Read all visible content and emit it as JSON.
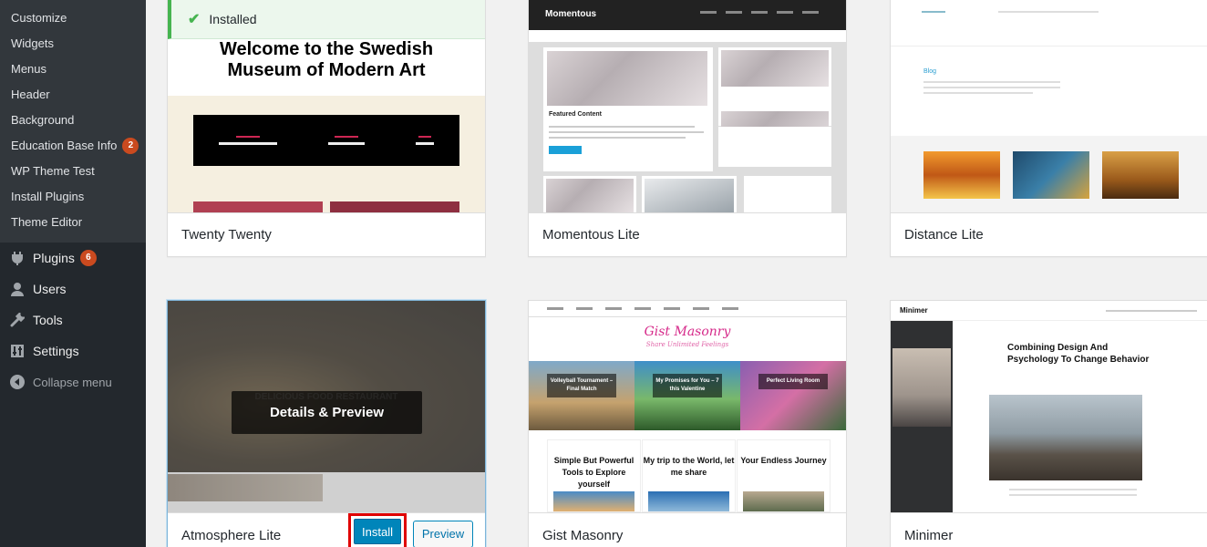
{
  "sidebar": {
    "submenu": [
      {
        "label": "Customize"
      },
      {
        "label": "Widgets"
      },
      {
        "label": "Menus"
      },
      {
        "label": "Header"
      },
      {
        "label": "Background"
      },
      {
        "label": "Education Base Info",
        "badge": "2"
      },
      {
        "label": "WP Theme Test"
      },
      {
        "label": "Install Plugins"
      },
      {
        "label": "Theme Editor"
      }
    ],
    "menu": [
      {
        "label": "Plugins",
        "badge": "6",
        "icon": "plugin-icon"
      },
      {
        "label": "Users",
        "icon": "users-icon"
      },
      {
        "label": "Tools",
        "icon": "wrench-icon"
      },
      {
        "label": "Settings",
        "icon": "settings-icon"
      }
    ],
    "collapse_label": "Collapse menu"
  },
  "themes": {
    "twenty_twenty": {
      "name": "Twenty Twenty",
      "installed_label": "Installed",
      "preview": {
        "heading_line1": "Welcome to the Swedish",
        "heading_line2": "Museum of Modern Art"
      }
    },
    "momentous": {
      "name": "Momentous Lite",
      "preview": {
        "logo": "Momentous",
        "featured_title": "Featured Content"
      }
    },
    "distance": {
      "name": "Distance Lite",
      "preview": {
        "blog_label": "Blog"
      }
    },
    "atmosphere": {
      "name": "Atmosphere Lite",
      "overlay_label": "Details & Preview",
      "preview": {
        "banner_text": "DELICIOUS FOOD RESTAURANT"
      },
      "install_label": "Install",
      "preview_button_label": "Preview"
    },
    "gist": {
      "name": "Gist Masonry",
      "preview": {
        "logo": "Gist Masonry",
        "tagline": "Share Unlimited Feelings",
        "strip": [
          "Volleyball Tournament – Final Match",
          "My Promises for You – 7 this Valentine",
          "Perfect Living Room"
        ],
        "posts": [
          "Simple But Powerful Tools to Explore yourself",
          "My trip to the World, let me share",
          "Your Endless Journey"
        ]
      }
    },
    "minimer": {
      "name": "Minimer",
      "preview": {
        "logo": "Minimer",
        "title_line1": "Combining Design And",
        "title_line2": "Psychology To Change Behavior"
      }
    }
  },
  "colors": {
    "sidebar_bg": "#23282d",
    "submenu_bg": "#32373c",
    "badge": "#ca4a1f",
    "primary": "#0085ba",
    "installed_green": "#46b450",
    "highlight_red": "#e00000"
  }
}
